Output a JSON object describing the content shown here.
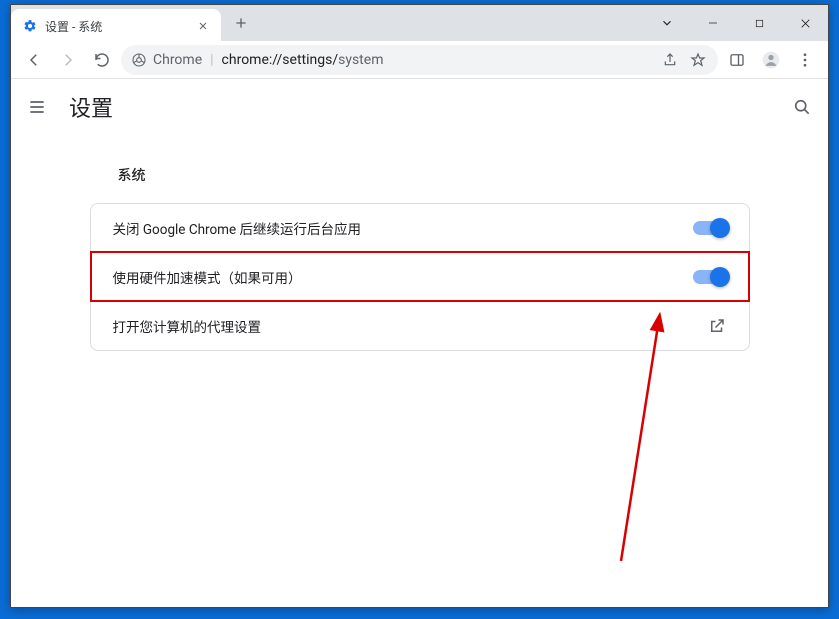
{
  "tab": {
    "title": "设置 - 系统"
  },
  "omnibox": {
    "site_name": "Chrome",
    "host": "chrome://",
    "path_prefix": "settings/",
    "path_page": "system"
  },
  "settings": {
    "title": "设置",
    "section_title": "系统",
    "rows": [
      {
        "label": "关闭 Google Chrome 后继续运行后台应用",
        "type": "toggle",
        "on": true
      },
      {
        "label": "使用硬件加速模式（如果可用）",
        "type": "toggle",
        "on": true,
        "highlight": true
      },
      {
        "label": "打开您计算机的代理设置",
        "type": "link"
      }
    ]
  }
}
